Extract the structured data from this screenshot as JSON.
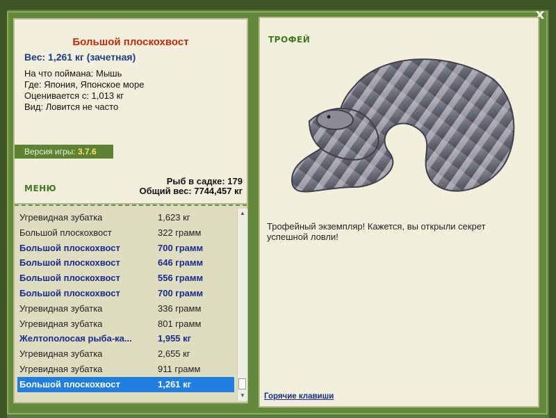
{
  "close_label": "x",
  "fish": {
    "title": "Большой плоскохвост",
    "weight": "Вес: 1,261 кг (зачетная)",
    "bait": "На что поймана: Мышь",
    "location": "Где: Япония, Японское море",
    "value": "Оценивается с: 1,013 кг",
    "kind": "Вид: Ловится не часто"
  },
  "version": {
    "label": "Версия игры: ",
    "value": "3.7.6"
  },
  "menu_label": "МЕНЮ",
  "counts": {
    "fish_in_net": "Рыб в садке: 179",
    "total_weight": "Общий вес: 7744,457 кг"
  },
  "catches": [
    {
      "name": "Угревидная зубатка",
      "weight": "1,623 кг",
      "style": "normal"
    },
    {
      "name": "Большой плоскохвост",
      "weight": "322 грамм",
      "style": "normal"
    },
    {
      "name": "Большой плоскохвост",
      "weight": "700 грамм",
      "style": "bold"
    },
    {
      "name": "Большой плоскохвост",
      "weight": "646 грамм",
      "style": "bold"
    },
    {
      "name": "Большой плоскохвост",
      "weight": "556 грамм",
      "style": "bold"
    },
    {
      "name": "Большой плоскохвост",
      "weight": "700 грамм",
      "style": "bold"
    },
    {
      "name": "Угревидная зубатка",
      "weight": "336 грамм",
      "style": "normal"
    },
    {
      "name": "Угревидная зубатка",
      "weight": "801 грамм",
      "style": "normal"
    },
    {
      "name": "Желтополосая рыба-ка...",
      "weight": "1,955 кг",
      "style": "bold"
    },
    {
      "name": "Угревидная зубатка",
      "weight": "2,655 кг",
      "style": "normal"
    },
    {
      "name": "Угревидная зубатка",
      "weight": "911 грамм",
      "style": "normal"
    },
    {
      "name": "Большой плоскохвост",
      "weight": "1,261 кг",
      "style": "selected"
    }
  ],
  "trophy": {
    "label": "ТРОФЕЙ",
    "image_icon": "sea-snake-image",
    "text": "Трофейный экземпляр! Кажется, вы открыли секрет успешной ловли!",
    "hotkeys": "Горячие клавиши"
  },
  "colors": {
    "frame_green": "#638a3b",
    "panel_bg": "#f2f0dc",
    "title_red": "#c02b0b",
    "link_blue": "#1a2a8e",
    "selected_blue": "#1f7ee0"
  }
}
